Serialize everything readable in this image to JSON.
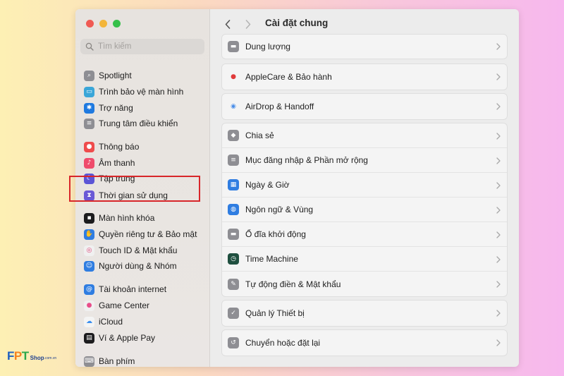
{
  "window": {
    "search_placeholder": "Tìm kiếm",
    "title": "Cài đặt chung"
  },
  "sidebar": {
    "items": [
      {
        "label": "Spotlight",
        "icon": "spotlight-icon",
        "color": "#8e8e93"
      },
      {
        "label": "Trình bảo vệ màn hình",
        "icon": "screensaver-icon",
        "color": "#3aa6d8"
      },
      {
        "label": "Trợ năng",
        "icon": "accessibility-icon",
        "color": "#1f7ae0"
      },
      {
        "label": "Trung tâm điều khiển",
        "icon": "control-center-icon",
        "color": "#8e8e93"
      },
      {
        "label": "Thông báo",
        "icon": "notifications-icon",
        "color": "#ef4c4c"
      },
      {
        "label": "Âm thanh",
        "icon": "sound-icon",
        "color": "#ef4c6c"
      },
      {
        "label": "Tập trung",
        "icon": "focus-icon",
        "color": "#5b55d6"
      },
      {
        "label": "Thời gian sử dụng",
        "icon": "screen-time-icon",
        "color": "#6a5ad6"
      },
      {
        "label": "Màn hình khóa",
        "icon": "lock-screen-icon",
        "color": "#1c1c1e"
      },
      {
        "label": "Quyền riêng tư & Bảo mật",
        "icon": "privacy-hand-icon",
        "color": "#2f7de1"
      },
      {
        "label": "Touch ID & Mật khẩu",
        "icon": "fingerprint-icon",
        "color": "#f0f0f0"
      },
      {
        "label": "Người dùng & Nhóm",
        "icon": "users-icon",
        "color": "#2f7de1"
      },
      {
        "label": "Tài khoản internet",
        "icon": "at-icon",
        "color": "#2f7de1"
      },
      {
        "label": "Game Center",
        "icon": "game-center-icon",
        "color": "#f0f0f0"
      },
      {
        "label": "iCloud",
        "icon": "icloud-icon",
        "color": "#f4f4f4"
      },
      {
        "label": "Ví & Apple Pay",
        "icon": "wallet-icon",
        "color": "#1c1c1e"
      },
      {
        "label": "Bàn phím",
        "icon": "keyboard-icon",
        "color": "#8e8e93"
      }
    ]
  },
  "main": {
    "groups": [
      {
        "rows": [
          {
            "label": "Dung lượng",
            "icon": "storage-icon",
            "color": "#8e8e93"
          }
        ]
      },
      {
        "rows": [
          {
            "label": "AppleCare & Bảo hành",
            "icon": "apple-icon",
            "color": "#f4f4f4"
          }
        ]
      },
      {
        "rows": [
          {
            "label": "AirDrop & Handoff",
            "icon": "airdrop-icon",
            "color": "#f4f4f4"
          }
        ]
      },
      {
        "rows": [
          {
            "label": "Chia sẻ",
            "icon": "sharing-icon",
            "color": "#8e8e93"
          },
          {
            "label": "Mục đăng nhập & Phần mở rộng",
            "icon": "login-items-icon",
            "color": "#8e8e93"
          },
          {
            "label": "Ngày & Giờ",
            "icon": "calendar-clock-icon",
            "color": "#2f7de1"
          },
          {
            "label": "Ngôn ngữ & Vùng",
            "icon": "globe-icon",
            "color": "#2f7de1"
          },
          {
            "label": "Ổ đĩa khởi động",
            "icon": "disk-icon",
            "color": "#8e8e93"
          },
          {
            "label": "Time Machine",
            "icon": "time-machine-icon",
            "color": "#1f4f3f"
          },
          {
            "label": "Tự động điền & Mật khẩu",
            "icon": "autofill-icon",
            "color": "#8e8e93"
          }
        ]
      },
      {
        "rows": [
          {
            "label": "Quản lý Thiết bị",
            "icon": "device-management-icon",
            "color": "#8e8e93"
          }
        ]
      },
      {
        "rows": [
          {
            "label": "Chuyển hoặc đặt lại",
            "icon": "reset-icon",
            "color": "#8e8e93"
          }
        ]
      }
    ]
  },
  "branding": {
    "fpt_f": "F",
    "fpt_p": "P",
    "fpt_t": "T",
    "shop": "Shop",
    "domain": ".com.vn",
    "colors": {
      "f": "#1d5fbf",
      "p": "#f58220",
      "t": "#2aa84a"
    }
  }
}
